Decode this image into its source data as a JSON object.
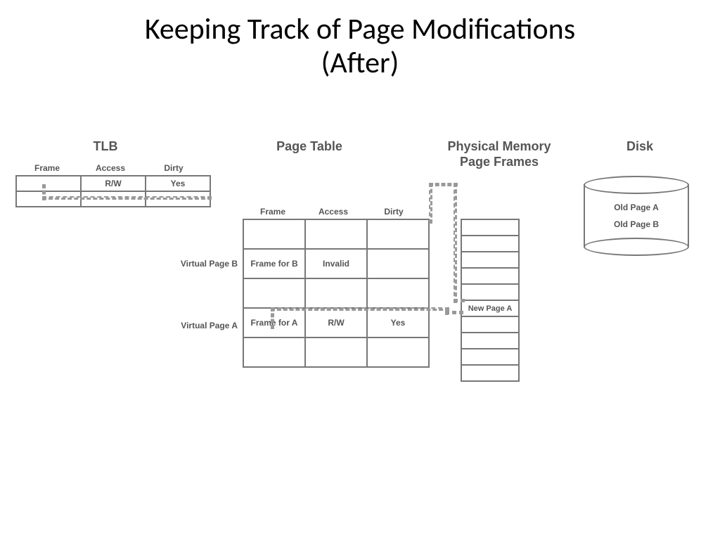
{
  "title_line1": "Keeping Track of Page Modifications",
  "title_line2": "(After)",
  "sections": {
    "tlb": "TLB",
    "pagetable": "Page Table",
    "physmem_l1": "Physical Memory",
    "physmem_l2": "Page Frames",
    "disk": "Disk"
  },
  "columns": {
    "frame": "Frame",
    "access": "Access",
    "dirty": "Dirty"
  },
  "tlb_row": {
    "frame": "",
    "access": "R/W",
    "dirty": "Yes"
  },
  "pt_rows": {
    "r0": {
      "label": "",
      "frame": "",
      "access": "",
      "dirty": ""
    },
    "r1": {
      "label": "Virtual Page B",
      "frame": "Frame for B",
      "access": "Invalid",
      "dirty": ""
    },
    "r2": {
      "label": "",
      "frame": "",
      "access": "",
      "dirty": ""
    },
    "r3": {
      "label": "Virtual Page A",
      "frame": "Frame for A",
      "access": "R/W",
      "dirty": "Yes"
    },
    "r4": {
      "label": "",
      "frame": "",
      "access": "",
      "dirty": ""
    }
  },
  "frames": {
    "slot5": "New Page A"
  },
  "disk": {
    "a": "Old Page A",
    "b": "Old Page B"
  }
}
